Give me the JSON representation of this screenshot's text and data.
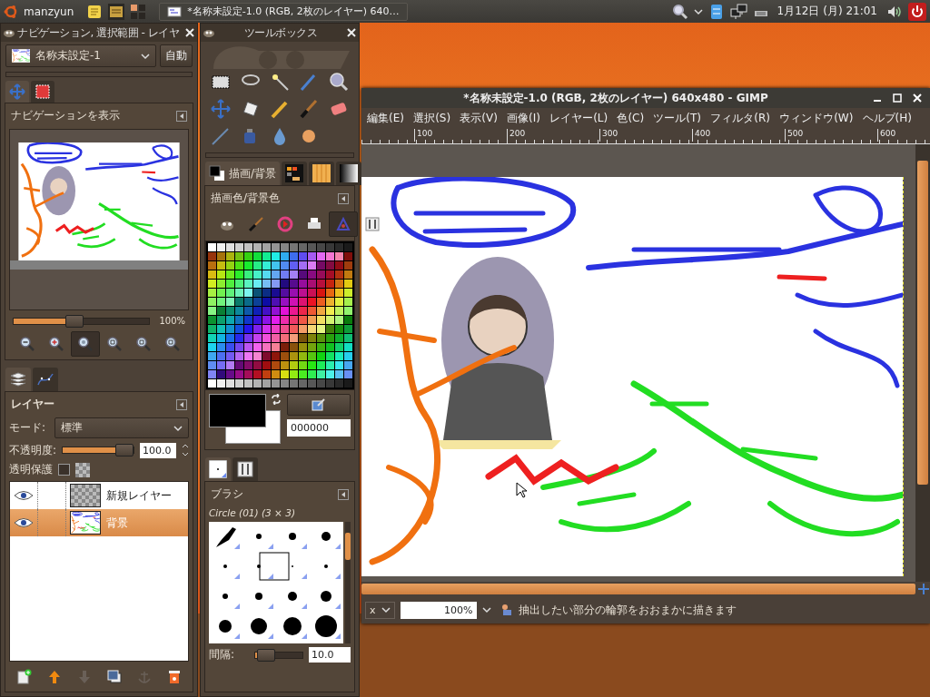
{
  "top_panel": {
    "user": "manzyun",
    "task_title": "*名称未設定-1.0 (RGB, 2枚のレイヤー) 640…",
    "clock": "1月12日 (月) 21:01"
  },
  "dock": {
    "title": "ナビゲーション, 選択範囲 - レイヤ",
    "image_name": "名称未設定-1",
    "auto_button": "自動",
    "tabs": [
      {
        "kind": "navigation",
        "selected": true
      },
      {
        "kind": "selection",
        "selected": false
      }
    ],
    "navigation": {
      "title": "ナビゲーションを表示",
      "zoom_slider": {
        "level": 0.45
      },
      "zoom_reading": "100%",
      "zoom_buttons": [
        {
          "kind": "zoom-out",
          "selected": false
        },
        {
          "kind": "zoom-in",
          "selected": false
        },
        {
          "kind": "zoom-actual",
          "selected": true
        },
        {
          "kind": "zoom-fit",
          "selected": false
        },
        {
          "kind": "zoom-fill",
          "selected": false
        },
        {
          "kind": "zoom-revert",
          "selected": false
        }
      ]
    },
    "layer_tabs": [
      {
        "kind": "layers",
        "selected": true
      },
      {
        "kind": "paths",
        "selected": false
      }
    ],
    "layers": {
      "title": "レイヤー",
      "mode_label": "モード:",
      "mode": "標準",
      "opacity_label": "不透明度:",
      "opacity_slider": {
        "level": 1
      },
      "opacity": "100.0",
      "lock_label": "透明保護",
      "lock_alpha": false,
      "items": [
        {
          "name": "新規レイヤー",
          "visible": true,
          "selected": false,
          "kind": "transparent"
        },
        {
          "name": "背景",
          "visible": true,
          "selected": true,
          "kind": "drawing"
        }
      ]
    }
  },
  "toolbox": {
    "title": "ツールボックス",
    "color_tabs": [
      {
        "kind": "fg-bg",
        "label": "描画/背景",
        "selected": true
      },
      {
        "kind": "palette",
        "selected": false
      },
      {
        "kind": "pattern",
        "selected": false
      },
      {
        "kind": "gradient",
        "selected": false
      }
    ],
    "colors": {
      "title": "描画色/背景色",
      "hex": "000000",
      "modes": [
        {
          "kind": "gimp",
          "selected": false
        },
        {
          "kind": "brush",
          "selected": false
        },
        {
          "kind": "wheel",
          "selected": false
        },
        {
          "kind": "printer",
          "selected": false
        },
        {
          "kind": "triangle",
          "selected": true
        },
        {
          "kind": "scales",
          "selected": false
        }
      ]
    },
    "brush_tabs": [
      {
        "kind": "brushes",
        "selected": true
      },
      {
        "kind": "tool-options",
        "selected": false
      }
    ],
    "brushes": {
      "title": "ブラシ",
      "brush_name": "Circle (01) (3 × 3)",
      "spacing_label": "間隔:",
      "spacing_slider": {
        "level": 0.04
      },
      "spacing": "10.0"
    }
  },
  "image_window": {
    "title": "*名称未設定-1.0 (RGB, 2枚のレイヤー) 640x480 - GIMP",
    "menu": [
      "編集(E)",
      "選択(S)",
      "表示(V)",
      "画像(I)",
      "レイヤー(L)",
      "色(C)",
      "ツール(T)",
      "フィルタ(R)",
      "ウィンドウ(W)",
      "ヘルプ(H)"
    ],
    "ruler_labels": [
      "100",
      "200",
      "300",
      "400",
      "500",
      "600"
    ],
    "status": {
      "unit": "x",
      "zoom": "100%",
      "message": "抽出したい部分の輪郭をおおまかに描きます"
    }
  }
}
